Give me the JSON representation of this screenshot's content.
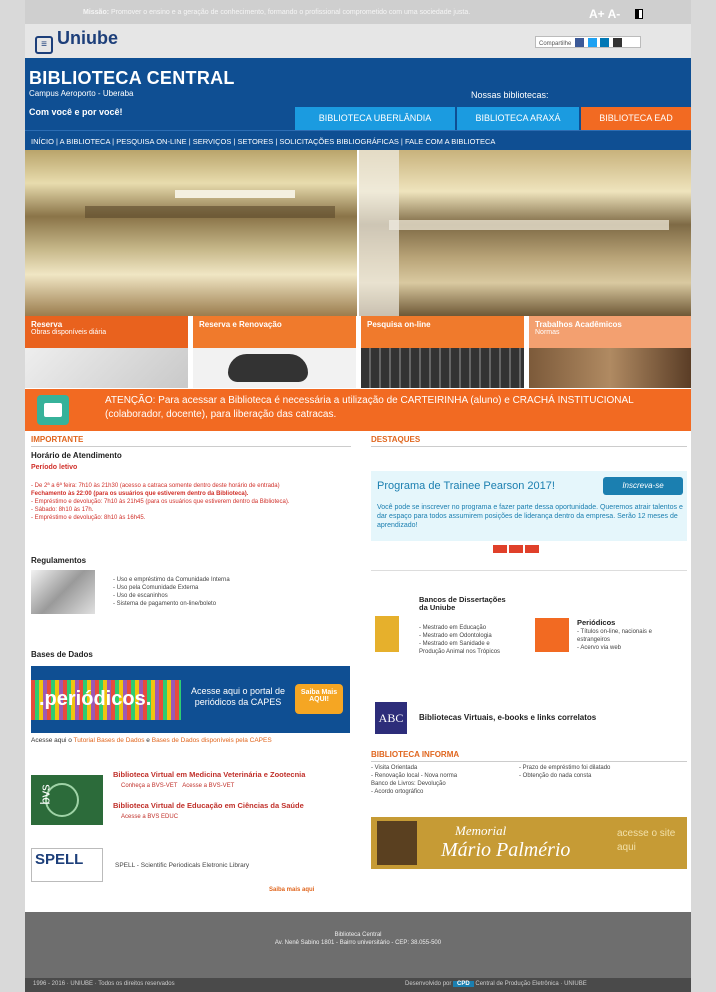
{
  "topbar": {
    "mission_label": "Missão:",
    "mission_text": "Promover o ensino e a geração de conhecimento, formando o profissional comprometido com uma sociedade justa.",
    "font_controls": "A+ A-"
  },
  "logo": {
    "name": "Uniube"
  },
  "share": {
    "label": "Compartilhe"
  },
  "header": {
    "title": "BIBLIOTECA CENTRAL",
    "subtitle": "Campus Aeroporto - Uberaba",
    "slogan": "Com você e por você!",
    "nossas": "Nossas bibliotecas:",
    "tabs": [
      {
        "label": "BIBLIOTECA UBERLÂNDIA",
        "color": "#1b9be0"
      },
      {
        "label": "BIBLIOTECA ARAXÁ",
        "color": "#1b9be0"
      },
      {
        "label": "BIBLIOTECA EAD",
        "color": "#f26a22"
      }
    ]
  },
  "nav": {
    "items": [
      "INÍCIO",
      "A BIBLIOTECA",
      "PESQUISA ON-LINE",
      "SERVIÇOS",
      "SETORES",
      "SOLICITAÇÕES BIBLIOGRÁFICAS",
      "FALE COM A BIBLIOTECA"
    ]
  },
  "tiles": [
    {
      "title": "Reserva",
      "sub": "Obras disponíveis diária",
      "color": "#e9621e"
    },
    {
      "title": "Reserva e Renovação",
      "sub": "",
      "color": "#f07a2c"
    },
    {
      "title": "Pesquisa on-line",
      "sub": "",
      "color": "#f07a2c"
    },
    {
      "title": "Trabalhos Acadêmicos",
      "sub": "Normas",
      "color": "#f3a070"
    }
  ],
  "alert": {
    "text": "ATENÇÃO: Para acessar a Biblioteca é necessária a utilização de CARTEIRINHA (aluno) e CRACHÁ INSTITUCIONAL (colaborador, docente), para liberação das catracas."
  },
  "importante": {
    "heading": "IMPORTANTE",
    "horario_title": "Horário de Atendimento",
    "periodo": "Período letivo",
    "lines": [
      "- De 2ª a 6ª feira: 7h10 às 21h30 (acesso a catraca somente dentro deste horário de entrada)",
      "Fechamento às 22:00 (para os usuários que estiverem dentro da Biblioteca).",
      "- Empréstimo e devolução: 7h10 às 21h45 (para os usuários que estiverem dentro da Biblioteca).",
      "- Sábado: 8h10 às 17h.",
      "- Empréstimo e devolução: 8h10 às 16h45."
    ]
  },
  "regulamentos": {
    "heading": "Regulamentos",
    "items": [
      "- Uso e empréstimo da Comunidade Interna",
      "- Uso pela Comunidade Externa",
      "- Uso de escaninhos",
      "- Sistema de pagamento on-line/boleto"
    ]
  },
  "bases": {
    "heading": "Bases de Dados",
    "banner_logo": ".periódicos.",
    "banner_text": "Acesse aqui o portal de periódicos da CAPES",
    "banner_button": "Saiba Mais AQUI!",
    "access_line_prefix": "Acesse aqui o",
    "access_link1": "Tutorial Bases de Dados",
    "access_mid": "e",
    "access_link2": "Bases de Dados disponíveis pela CAPES"
  },
  "bvs": {
    "title1": "Biblioteca Virtual em Medicina Veterinária e Zootecnia",
    "link1a": "Conheça a BVS-VET",
    "link1b": "Acesse a BVS-VET",
    "title2": "Biblioteca Virtual de Educação em Ciências da Saúde",
    "link2": "Acesse a BVS EDUC",
    "logo_text": "bvs"
  },
  "spell": {
    "logo": "SPELL",
    "text": "SPELL - Scientific Periodicals Eletronic Library",
    "saiba": "Saiba mais aqui"
  },
  "destaques": {
    "heading": "DESTAQUES",
    "trainee_title": "Programa de Trainee Pearson 2017!",
    "trainee_btn": "Inscreva-se",
    "trainee_text": "Você pode se inscrever no programa e fazer parte dessa oportunidade. Queremos atrair talentos e dar espaço para todos assumirem posições de liderança dentro da empresa. Serão 12 meses de aprendizado!"
  },
  "bancos": {
    "title": "Bancos de Dissertações da Uniube",
    "items": [
      "- Mestrado em Educação",
      "- Mestrado em Odontologia",
      "- Mestrado em Sanidade e Produção Animal nos Trópicos"
    ]
  },
  "periodicos_box": {
    "title": "Periódicos",
    "items": [
      "- Títulos on-line, nacionais e estrangeiros",
      "- Acervo via web"
    ]
  },
  "virtuais": {
    "abc": "ABC",
    "text": "Bibliotecas Virtuais, e-books e links correlatos"
  },
  "informa": {
    "heading": "BIBLIOTECA INFORMA",
    "left": [
      "- Visita Orientada",
      "- Renovação local - Nova norma",
      "  Banco de Livros: Devolução",
      "- Acordo ortográfico"
    ],
    "right": [
      "- Prazo de empréstimo foi dilatado",
      "- Obtenção do nada consta"
    ]
  },
  "memorial": {
    "title": "Memorial",
    "name": "Mário Palmério",
    "cta": "acesse o site aqui"
  },
  "footer": {
    "line1": "Biblioteca Central",
    "line2": "Av. Nenê Sabino 1801 - Bairro universitário - CEP: 38.055-500",
    "copyright": "1996 - 2016 · UNIUBE · Todos os direitos reservados",
    "dev_prefix": "Desenvolvido por",
    "dev_logo": "CPD",
    "dev_suffix": "Central de Produção Eletrônica · UNIUBE"
  }
}
